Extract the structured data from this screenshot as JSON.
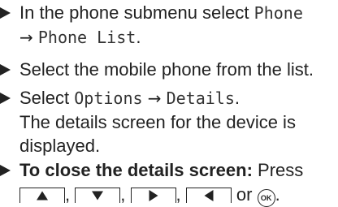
{
  "steps": [
    {
      "line1_prefix": "In the phone submenu select ",
      "line1_menu": "Phone",
      "line2_arrow": "→",
      "line2_menu": "Phone List",
      "line2_suffix": "."
    },
    {
      "text": "Select the mobile phone from the list."
    },
    {
      "prefix": "Select ",
      "menu_a": "Options",
      "arrow": "→",
      "menu_b": "Details",
      "suffix": ".",
      "result_line1": "The details screen for the device is",
      "result_line2": "displayed."
    },
    {
      "bold": "To close the details screen:",
      "action": " Press",
      "keys": [
        "up-arrow",
        "down-arrow",
        "right-arrow",
        "left-arrow"
      ],
      "separator": ",",
      "or": "or",
      "ok_label": "OK",
      "end": "."
    }
  ]
}
